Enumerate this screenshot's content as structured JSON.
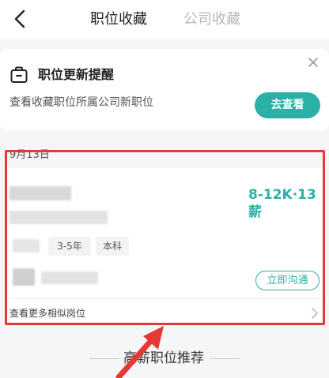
{
  "header": {
    "tabs": [
      {
        "label": "职位收藏",
        "active": true
      },
      {
        "label": "公司收藏",
        "active": false
      }
    ]
  },
  "reminder": {
    "title": "职位更新提醒",
    "description": "查看收藏职位所属公司新职位",
    "button_label": "去查看"
  },
  "date_label": "9月13日",
  "job_card": {
    "salary": "8-12K·13薪",
    "tags": [
      "3-5年",
      "本科"
    ],
    "chat_button_label": "立即沟通",
    "more_similar_label": "查看更多相似岗位"
  },
  "recommend": {
    "title": "高薪职位推荐"
  },
  "colors": {
    "accent": "#2bb0a7",
    "highlight": "#e53935",
    "background": "#f5f6f7"
  }
}
